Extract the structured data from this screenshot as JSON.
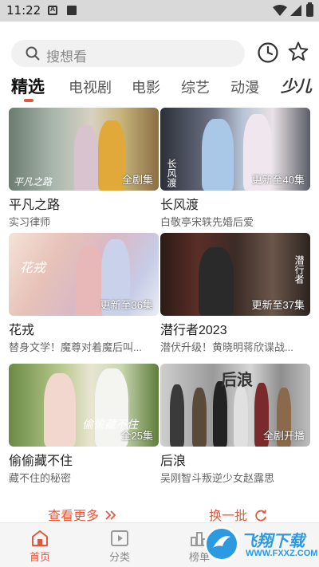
{
  "status_bar": {
    "time": "11:22"
  },
  "search": {
    "placeholder": "搜想看"
  },
  "tabs": [
    {
      "label": "精选",
      "active": true
    },
    {
      "label": "电视剧",
      "active": false
    },
    {
      "label": "电影",
      "active": false
    },
    {
      "label": "综艺",
      "active": false
    },
    {
      "label": "动漫",
      "active": false
    },
    {
      "label": "少儿",
      "active": false
    }
  ],
  "cards": [
    {
      "title": "平凡之路",
      "subtitle": "实习律师",
      "badge": "全剧集",
      "logo_text": "平凡之路"
    },
    {
      "title": "长风渡",
      "subtitle": "白敬亭宋轶先婚后爱",
      "badge": "更新至40集",
      "logo_text": "长风渡"
    },
    {
      "title": "花戎",
      "subtitle": "替身文学！魔尊对着魔后叫...",
      "badge": "更新至36集",
      "logo_text": "花戎"
    },
    {
      "title": "潜行者2023",
      "subtitle": "潜伏升级！黄晓明蒋欣谍战...",
      "badge": "更新至37集",
      "logo_text": "潜行者"
    },
    {
      "title": "偷偷藏不住",
      "subtitle": "藏不住的秘密",
      "badge": "全25集",
      "logo_text": "偷偷藏不住"
    },
    {
      "title": "后浪",
      "subtitle": "吴刚智斗叛逆少女赵露思",
      "badge": "全剧开播",
      "logo_text": "后浪"
    }
  ],
  "actions": {
    "more": "查看更多",
    "refresh": "换一批"
  },
  "bottom_nav": [
    {
      "label": "首页",
      "icon": "home-icon",
      "active": true
    },
    {
      "label": "分类",
      "icon": "play-square-icon",
      "active": false
    },
    {
      "label": "榜单",
      "icon": "rank-icon",
      "active": false
    }
  ],
  "watermark": {
    "title": "飞翔下载",
    "url": "WWW.FXXZ.COM"
  },
  "colors": {
    "accent": "#e4573b",
    "watermark": "#2b9ae0"
  }
}
